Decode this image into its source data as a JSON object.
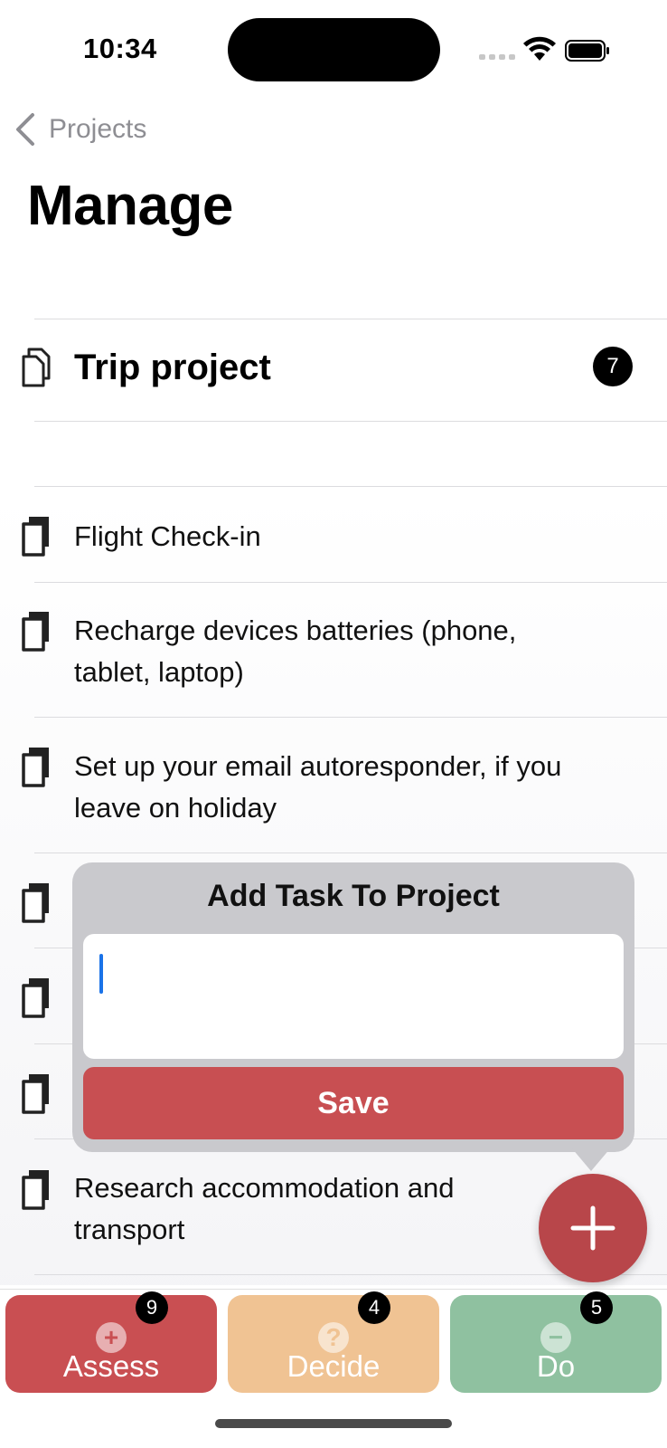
{
  "status": {
    "time": "10:34"
  },
  "nav": {
    "back_label": "Projects",
    "title": "Manage"
  },
  "project": {
    "name": "Trip project",
    "count": "7"
  },
  "tasks": [
    {
      "label": "Flight Check-in"
    },
    {
      "label": "Recharge devices batteries (phone, tablet, laptop)"
    },
    {
      "label": "Set up your email autoresponder, if you leave on holiday"
    },
    {
      "label": "Research accommodation and transport"
    }
  ],
  "popover": {
    "title": "Add Task To Project",
    "input_value": "",
    "save_label": "Save"
  },
  "fab": {
    "icon": "plus-icon"
  },
  "tabs": [
    {
      "label": "Assess",
      "badge": "9",
      "icon": "+",
      "color": "#c94f52"
    },
    {
      "label": "Decide",
      "badge": "4",
      "icon": "?",
      "color": "#f0c393"
    },
    {
      "label": "Do",
      "badge": "5",
      "icon": "−",
      "color": "#8fc1a0"
    }
  ]
}
